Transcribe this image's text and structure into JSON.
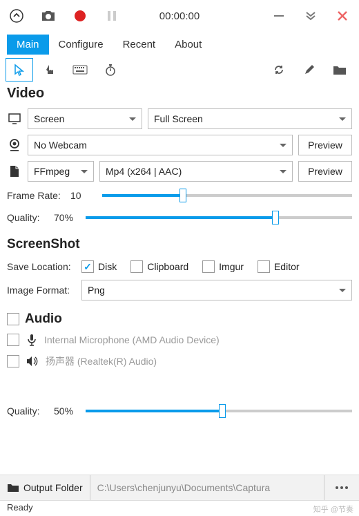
{
  "timer": "00:00:00",
  "tabs": {
    "main": "Main",
    "configure": "Configure",
    "recent": "Recent",
    "about": "About"
  },
  "video": {
    "heading": "Video",
    "source": "Screen",
    "region": "Full Screen",
    "webcam": "No Webcam",
    "preview1": "Preview",
    "encoder": "FFmpeg",
    "format": "Mp4 (x264 | AAC)",
    "preview2": "Preview",
    "frameRateLabel": "Frame Rate:",
    "frameRateValue": "10",
    "qualityLabel": "Quality:",
    "qualityValue": "70%"
  },
  "screenshot": {
    "heading": "ScreenShot",
    "saveLocLabel": "Save Location:",
    "disk": "Disk",
    "clipboard": "Clipboard",
    "imgur": "Imgur",
    "editor": "Editor",
    "formatLabel": "Image Format:",
    "formatValue": "Png"
  },
  "audio": {
    "heading": "Audio",
    "mic": "Internal Microphone (AMD Audio Device)",
    "speaker": "扬声器 (Realtek(R) Audio)",
    "qualityLabel": "Quality:",
    "qualityValue": "50%"
  },
  "bottom": {
    "outputFolder": "Output Folder",
    "path": "C:\\Users\\chenjunyu\\Documents\\Captura"
  },
  "status": "Ready",
  "watermark": "知乎 @节奏"
}
